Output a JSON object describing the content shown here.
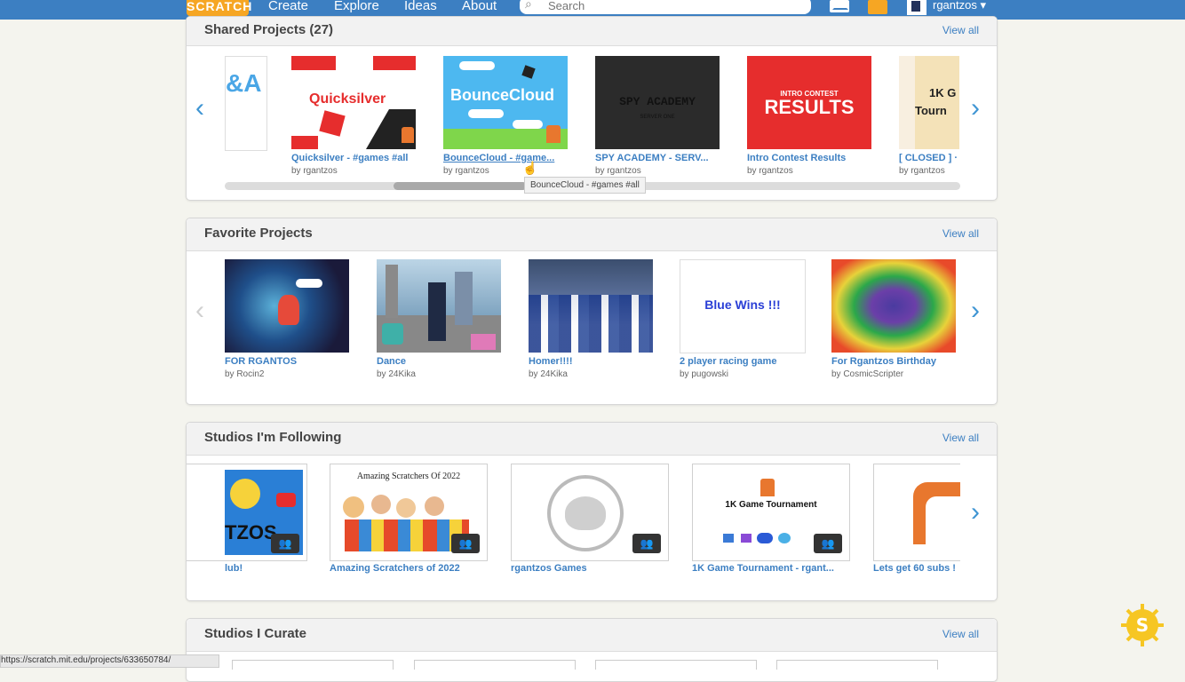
{
  "topbar": {
    "logo_text": "SCRATCH",
    "nav": [
      "Create",
      "Explore",
      "Ideas",
      "About"
    ],
    "search_placeholder": "Search",
    "username": "rgantzos ▾"
  },
  "shared": {
    "title": "Shared Projects (27)",
    "view_all": "View all",
    "projects": [
      {
        "title": "Quicksilver - #games #all",
        "by": "by rgantzos",
        "thumb_text": "Quicksilver"
      },
      {
        "title": "BounceCloud - #game...",
        "by": "by rgantzos",
        "thumb_text": "BounceCloud"
      },
      {
        "title": "SPY ACADEMY - SERV...",
        "by": "by rgantzos",
        "thumb_text": "SPY ACADEMY",
        "thumb_sub": "SERVER ONE"
      },
      {
        "title": "Intro Contest Results",
        "by": "by rgantzos",
        "thumb_text": "RESULTS",
        "thumb_sub": "INTRO CONTEST"
      },
      {
        "title": "[ CLOSED ] ·",
        "by": "by rgantzos",
        "thumb_text": "1K G",
        "thumb_sub": "Tourn"
      }
    ],
    "partial_thumb_text": "&A",
    "tooltip": "BounceCloud - #games #all"
  },
  "favorites": {
    "title": "Favorite Projects",
    "view_all": "View all",
    "projects": [
      {
        "title": "FOR RGANTOS",
        "by": "by Rocin2"
      },
      {
        "title": "Dance",
        "by": "by 24Kika"
      },
      {
        "title": "Homer!!!!",
        "by": "by 24Kika"
      },
      {
        "title": "2 player racing game",
        "by": "by pugowski",
        "thumb_text": "Blue Wins !!!"
      },
      {
        "title": "For Rgantzos Birthday",
        "by": "by CosmicScripter"
      }
    ]
  },
  "following": {
    "title": "Studios I'm Following",
    "view_all": "View all",
    "studios": [
      {
        "title": "lub!",
        "thumb_text": "TZOS"
      },
      {
        "title": "Amazing Scratchers of 2022",
        "thumb_text": "Amazing Scratchers Of 2022"
      },
      {
        "title": "rgantzos Games"
      },
      {
        "title": "1K Game Tournament - rgant...",
        "thumb_text": "1K Game Tournament"
      },
      {
        "title": "Lets get 60 subs !"
      }
    ]
  },
  "curate": {
    "title": "Studios I Curate",
    "view_all": "View all"
  },
  "status_url": "https://scratch.mit.edu/projects/633650784/",
  "colors": {
    "topbar": "#3c7fc2",
    "link": "#3c7fc2",
    "accent": "#f6a623"
  }
}
